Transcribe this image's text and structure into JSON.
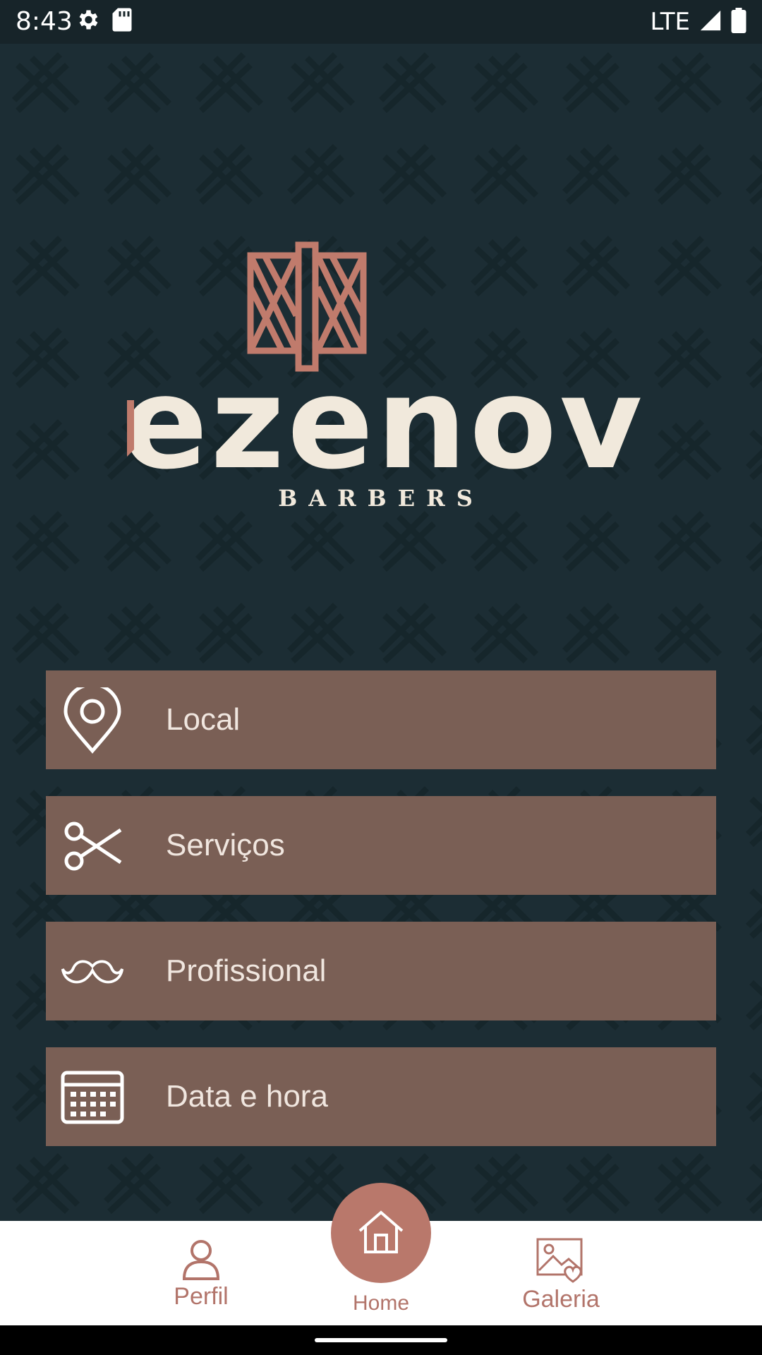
{
  "status": {
    "time": "8:43",
    "network": "LTE",
    "icons": [
      "gear-icon",
      "sd-card-icon",
      "signal-icon",
      "battery-icon"
    ]
  },
  "brand": {
    "wordmark": "dezenove",
    "subtitle": "BARBERS",
    "colors": {
      "accent": "#c07b6c",
      "cream": "#f1e9dc"
    }
  },
  "menu": {
    "items": [
      {
        "label": "Local",
        "icon": "map-pin-icon"
      },
      {
        "label": "Serviços",
        "icon": "scissors-icon"
      },
      {
        "label": "Profissional",
        "icon": "mustache-icon"
      },
      {
        "label": "Data e hora",
        "icon": "calendar-icon"
      }
    ]
  },
  "nav": {
    "items": [
      {
        "label": "Perfil",
        "icon": "person-icon"
      },
      {
        "label": "Home",
        "icon": "home-icon",
        "active": true
      },
      {
        "label": "Galeria",
        "icon": "gallery-icon"
      }
    ]
  },
  "colors": {
    "background": "#1c2d34",
    "menu_item": "#7a5f55",
    "nav_accent": "#b9786b"
  }
}
